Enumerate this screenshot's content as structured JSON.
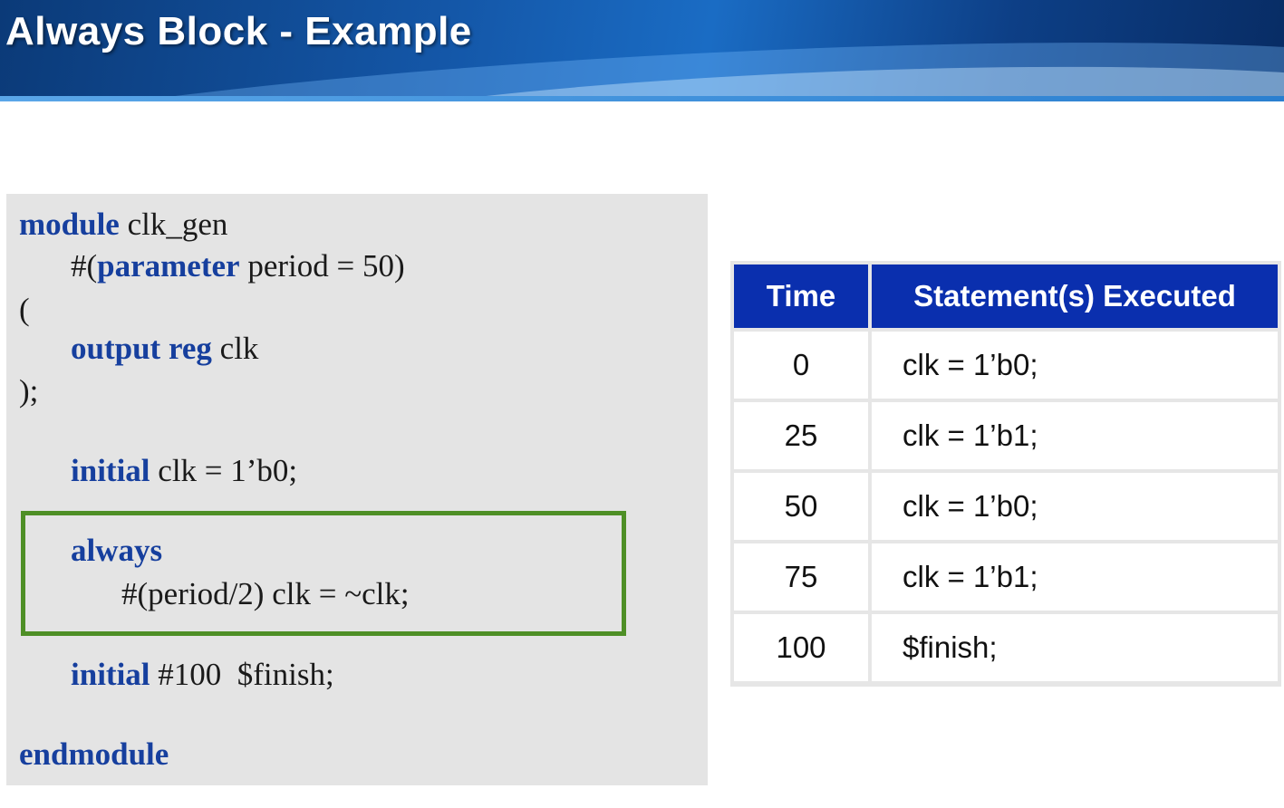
{
  "title": "Always Block - Example",
  "code": {
    "line1_kw": "module",
    "line1_rest": " clk_gen",
    "line2_pre": "#(",
    "line2_kw": "parameter",
    "line2_rest": " period = 50)",
    "line3": "(",
    "line4_kw": "output reg",
    "line4_rest": " clk",
    "line5": ");",
    "line6_kw": "initial",
    "line6_rest": " clk = 1’b0;",
    "line7_kw": "always",
    "line8": "#(period/2) clk = ~clk;",
    "line9_kw": "initial",
    "line9_rest": " #100  $finish;",
    "line10_kw": "endmodule"
  },
  "table": {
    "headers": [
      "Time",
      "Statement(s) Executed"
    ],
    "rows": [
      {
        "time": "0",
        "stmt": "clk = 1’b0;"
      },
      {
        "time": "25",
        "stmt": "clk = 1’b1;"
      },
      {
        "time": "50",
        "stmt": "clk = 1’b0;"
      },
      {
        "time": "75",
        "stmt": "clk = 1’b1;"
      },
      {
        "time": "100",
        "stmt": "$finish;"
      }
    ]
  },
  "colors": {
    "header_bg": "#1457a8",
    "keyword": "#163f9e",
    "highlight_border": "#4e8f26",
    "table_header_bg": "#0a2fae"
  }
}
